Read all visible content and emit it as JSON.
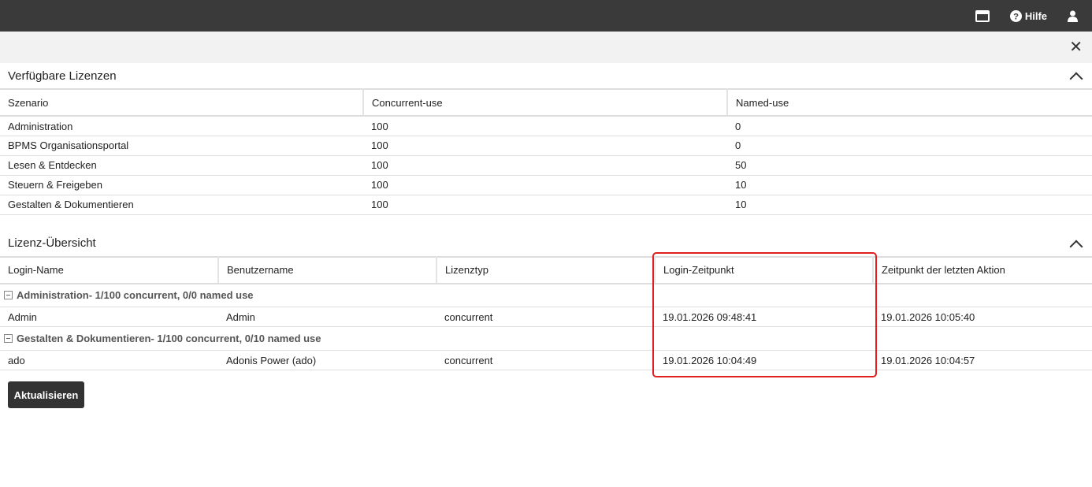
{
  "topbar": {
    "help_label": "Hilfe"
  },
  "available": {
    "title": "Verfügbare Lizenzen",
    "columns": [
      "Szenario",
      "Concurrent-use",
      "Named-use"
    ],
    "rows": [
      [
        "Administration",
        "100",
        "0"
      ],
      [
        "BPMS Organisationsportal",
        "100",
        "0"
      ],
      [
        "Lesen & Entdecken",
        "100",
        "50"
      ],
      [
        "Steuern & Freigeben",
        "100",
        "10"
      ],
      [
        "Gestalten & Dokumentieren",
        "100",
        "10"
      ]
    ]
  },
  "overview": {
    "title": "Lizenz-Übersicht",
    "columns": [
      "Login-Name",
      "Benutzername",
      "Lizenztyp",
      "Login-Zeitpunkt",
      "Zeitpunkt der letzten Aktion"
    ],
    "groups": [
      {
        "label": "Administration- 1/100 concurrent, 0/0 named use",
        "row": [
          "Admin",
          "Admin",
          "concurrent",
          "19.01.2026 09:48:41",
          "19.01.2026 10:05:40"
        ]
      },
      {
        "label": "Gestalten & Dokumentieren- 1/100 concurrent, 0/10 named use",
        "row": [
          "ado",
          "Adonis Power (ado)",
          "concurrent",
          "19.01.2026 10:04:49",
          "19.01.2026 10:04:57"
        ]
      }
    ]
  },
  "refresh_label": "Aktualisieren"
}
